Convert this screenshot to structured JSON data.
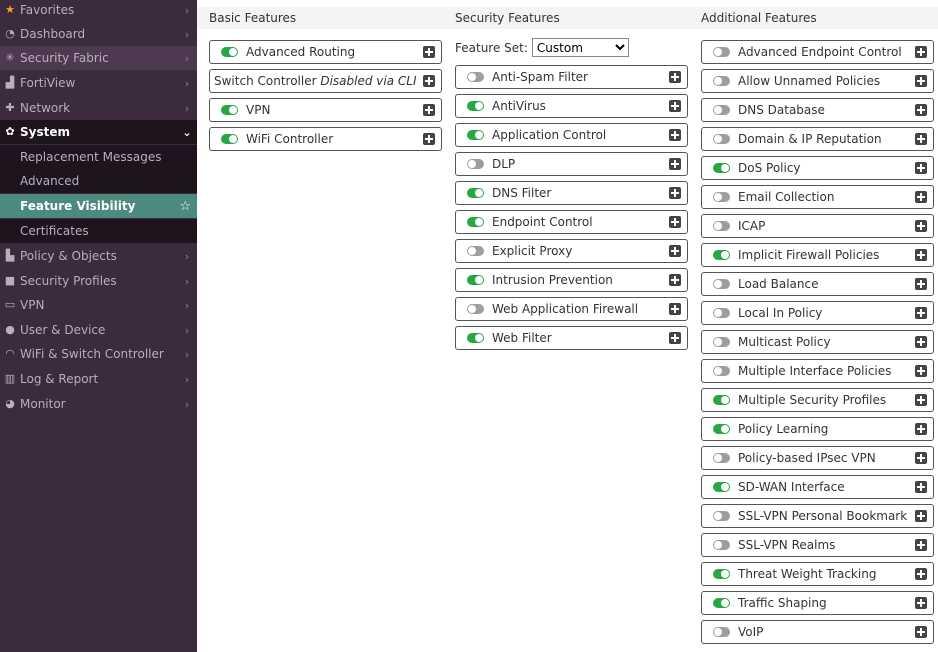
{
  "sidebar": {
    "items": [
      {
        "label": "Favorites",
        "icon": "star-icon"
      },
      {
        "label": "Dashboard",
        "icon": "dashboard-icon"
      },
      {
        "label": "Security Fabric",
        "icon": "fabric-icon"
      },
      {
        "label": "FortiView",
        "icon": "chart-icon"
      },
      {
        "label": "Network",
        "icon": "network-icon"
      },
      {
        "label": "System",
        "icon": "gear-icon"
      },
      {
        "label": "Policy & Objects",
        "icon": "policy-icon"
      },
      {
        "label": "Security Profiles",
        "icon": "lock-icon"
      },
      {
        "label": "VPN",
        "icon": "monitor-icon"
      },
      {
        "label": "User & Device",
        "icon": "user-icon"
      },
      {
        "label": "WiFi & Switch Controller",
        "icon": "wifi-icon"
      },
      {
        "label": "Log & Report",
        "icon": "bar-chart-icon"
      },
      {
        "label": "Monitor",
        "icon": "pie-icon"
      }
    ],
    "system_sub": [
      {
        "label": "Replacement Messages"
      },
      {
        "label": "Advanced"
      },
      {
        "label": "Feature Visibility"
      },
      {
        "label": "Certificates"
      }
    ]
  },
  "basic": {
    "header": "Basic Features",
    "items": [
      {
        "label": "Advanced Routing",
        "on": true
      },
      {
        "label": "Switch Controller",
        "note": "Disabled via CLI"
      },
      {
        "label": "VPN",
        "on": true
      },
      {
        "label": "WiFi Controller",
        "on": true
      }
    ]
  },
  "security": {
    "header": "Security Features",
    "feature_set_label": "Feature Set:",
    "feature_set_value": "Custom",
    "items": [
      {
        "label": "Anti-Spam Filter",
        "on": false
      },
      {
        "label": "AntiVirus",
        "on": true
      },
      {
        "label": "Application Control",
        "on": true
      },
      {
        "label": "DLP",
        "on": false
      },
      {
        "label": "DNS Filter",
        "on": true
      },
      {
        "label": "Endpoint Control",
        "on": true
      },
      {
        "label": "Explicit Proxy",
        "on": false
      },
      {
        "label": "Intrusion Prevention",
        "on": true
      },
      {
        "label": "Web Application Firewall",
        "on": false
      },
      {
        "label": "Web Filter",
        "on": true
      }
    ]
  },
  "additional": {
    "header": "Additional Features",
    "items": [
      {
        "label": "Advanced Endpoint Control",
        "on": false
      },
      {
        "label": "Allow Unnamed Policies",
        "on": false
      },
      {
        "label": "DNS Database",
        "on": false
      },
      {
        "label": "Domain & IP Reputation",
        "on": false
      },
      {
        "label": "DoS Policy",
        "on": true
      },
      {
        "label": "Email Collection",
        "on": false
      },
      {
        "label": "ICAP",
        "on": false
      },
      {
        "label": "Implicit Firewall Policies",
        "on": true
      },
      {
        "label": "Load Balance",
        "on": false
      },
      {
        "label": "Local In Policy",
        "on": false
      },
      {
        "label": "Multicast Policy",
        "on": false
      },
      {
        "label": "Multiple Interface Policies",
        "on": false
      },
      {
        "label": "Multiple Security Profiles",
        "on": true
      },
      {
        "label": "Policy Learning",
        "on": true
      },
      {
        "label": "Policy-based IPsec VPN",
        "on": false
      },
      {
        "label": "SD-WAN Interface",
        "on": true
      },
      {
        "label": "SSL-VPN Personal Bookmark",
        "on": false
      },
      {
        "label": "SSL-VPN Realms",
        "on": false
      },
      {
        "label": "Threat Weight Tracking",
        "on": true
      },
      {
        "label": "Traffic Shaping",
        "on": true
      },
      {
        "label": "VoIP",
        "on": false
      }
    ]
  },
  "colors": {
    "toggle_on": "#28a745",
    "toggle_off": "#9e9e9e",
    "sidebar_bg": "#3c2a3d",
    "selected_bg": "#4b8a7c"
  }
}
